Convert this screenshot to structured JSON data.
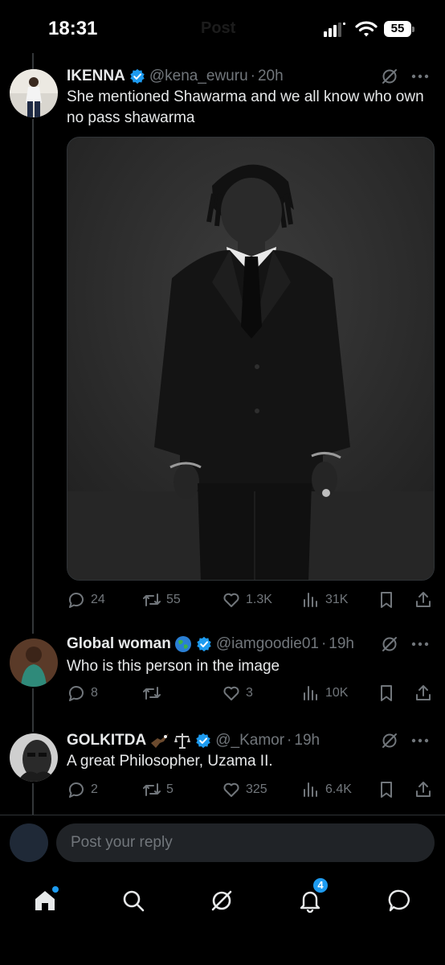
{
  "status_bar": {
    "time": "18:31",
    "title_ghost": "Post",
    "battery": "55"
  },
  "tweets": [
    {
      "name": "IKENNA",
      "handle": "@kena_ewuru",
      "time": "20h",
      "text": "She mentioned Shawarma and we all know who own no pass shawarma",
      "metrics": {
        "replies": "24",
        "reposts": "55",
        "likes": "1.3K",
        "views": "31K"
      }
    },
    {
      "name": "Global woman",
      "handle": "@iamgoodie01",
      "time": "19h",
      "text": "Who is this person in the image",
      "metrics": {
        "replies": "8",
        "reposts": "",
        "likes": "3",
        "views": "10K"
      }
    },
    {
      "name": "GOLKITDA",
      "handle": "@_Kamor",
      "time": "19h",
      "text": "A great Philosopher, Uzama II.",
      "metrics": {
        "replies": "2",
        "reposts": "5",
        "likes": "325",
        "views": "6.4K"
      }
    }
  ],
  "reply": {
    "placeholder": "Post your reply"
  },
  "nav": {
    "notifications_count": "4"
  },
  "colors": {
    "background": "#000000",
    "accent": "#1d9bf0",
    "muted": "#71767b",
    "text": "#e7e9ea"
  },
  "icons": [
    "signal-icon",
    "wifi-icon",
    "verified-icon",
    "grok-icon",
    "more-icon",
    "reply-icon",
    "repost-icon",
    "like-icon",
    "views-icon",
    "bookmark-icon",
    "share-icon",
    "home-icon",
    "search-icon",
    "grok-nav-icon",
    "bell-icon",
    "messages-icon"
  ]
}
